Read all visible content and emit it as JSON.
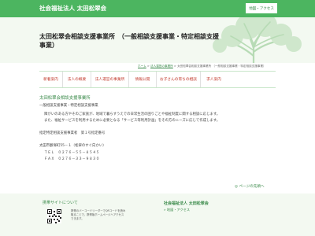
{
  "header": {
    "site_name": "社会福祉法人 太田松翠会",
    "map_access_link": "地図・アクセス",
    "office_title": "太田松翠会相談支援事業所　（一般相談支援事業・特定相談支援事業）"
  },
  "breadcrumb": {
    "home": "ホーム",
    "corporation_services": "法人運営の事業所",
    "current": "太田松翠会相談支援事業所 （一般相談支援事業・特定相談支援事業）",
    "separator": ">"
  },
  "nav": {
    "items": [
      {
        "label": "新着案内"
      },
      {
        "label": "法人の概要"
      },
      {
        "label": "法人運営の事業所"
      },
      {
        "label": "情報公開"
      },
      {
        "label": "お子さんの育ちの相談"
      },
      {
        "label": "求人案内"
      }
    ]
  },
  "content": {
    "title": "太田松翠会相談支援事業所",
    "service_type": "一般相談支援事業・特定相談支援事業",
    "desc_line1": "障がいのある方やそのご家族が、地域で暮らすうえでの日常生活の困りごとや福祉制度に関する相談に応じます。",
    "desc_line2": "また、福祉サービスを利用するために必要となる「サービス等利用計画」をその方のニーズに応じて作成します。",
    "designation": "指定特定相談支援事業者　第１号指定番号",
    "address": "太田市藪塚町55－１（松翠のすぐ向かい）",
    "tel": "ＴＥＬ　０２７６－５５－８５４５",
    "fax": "ＦＡＸ　０２７６－３３－９８３０",
    "page_top": "ページの先頭へ"
  },
  "footer": {
    "mobile_title": "携帯サイトについて",
    "mobile_desc": "携帯のバーコードリーダーでQRコードを読み取ることで、携帯版ホームページへアクセスできます。",
    "org_name": "社会福祉法人 太田松翠会",
    "map_link": "地図・アクセス"
  },
  "colors": {
    "accent_green": "#4cb560",
    "nav_text": "#c0392b",
    "pale_green": "#f3f9f1"
  }
}
